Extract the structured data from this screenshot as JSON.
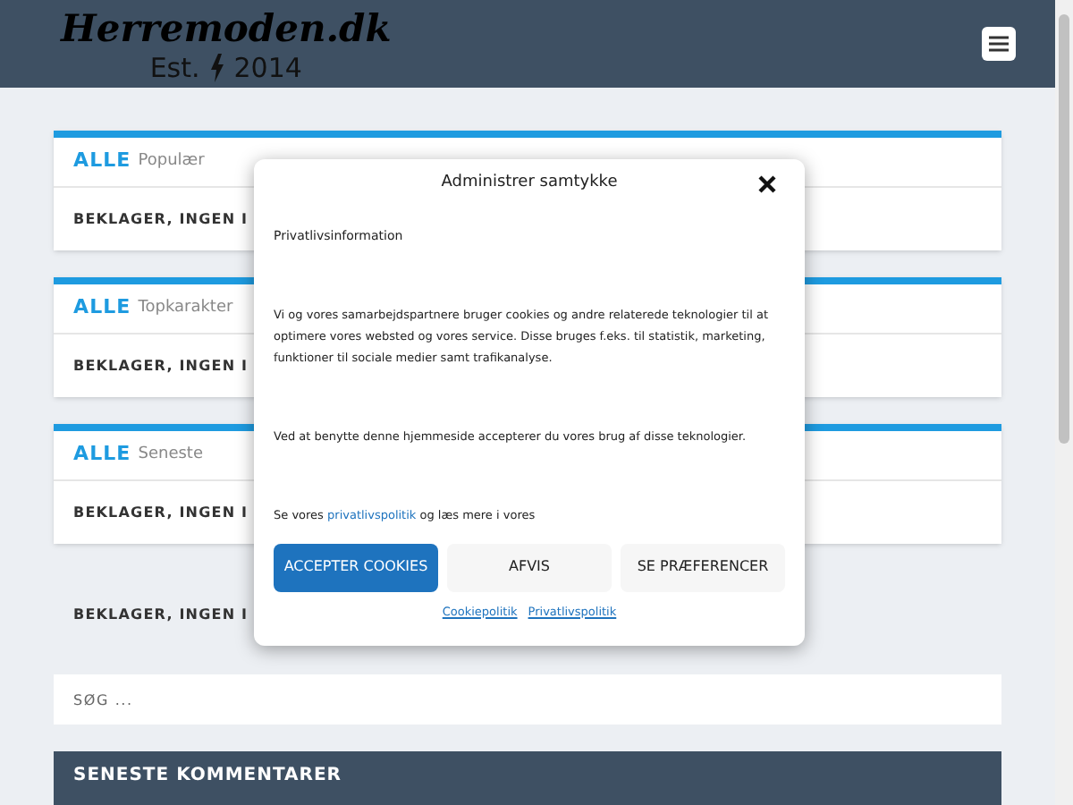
{
  "header": {
    "logo": {
      "name": "Herremoden.dk",
      "est": "Est.",
      "year": "2014"
    }
  },
  "cards": [
    {
      "tag": "ALLE",
      "title": "Populær",
      "message": "BEKLAGER, INGEN I"
    },
    {
      "tag": "ALLE",
      "title": "Topkarakter",
      "message": "BEKLAGER, INGEN I"
    },
    {
      "tag": "ALLE",
      "title": "Seneste",
      "message": "BEKLAGER, INGEN I"
    }
  ],
  "plain_message": "BEKLAGER, INGEN I",
  "search": {
    "placeholder": "SØG ..."
  },
  "widget_title": "SENESTE KOMMENTARER",
  "consent_dialog": {
    "title": "Administrer samtykke",
    "section": "Privatlivsinformation",
    "paragraphs": [
      "Vi og vores samarbejdspartnere bruger cookies og andre relaterede teknologier til at optimere vores websted og vores service. Disse bruges f.eks. til statistik, marketing, funktioner til sociale medier samt trafikanalyse.",
      "Ved at benytte denne hjemmeside accepterer du vores brug af disse teknologier."
    ],
    "read_more": {
      "before": "Se vores",
      "link": "privatlivspolitik",
      "after": "og læs mere i vores"
    },
    "buttons": [
      {
        "label": "ACCEPTER COOKIES",
        "kind": "primary"
      },
      {
        "label": "AFVIS",
        "kind": "secondary"
      },
      {
        "label": "SE PRÆFERENCER",
        "kind": "secondary"
      }
    ],
    "links": [
      "Cookiepolitik",
      "Privatlivspolitik"
    ]
  }
}
